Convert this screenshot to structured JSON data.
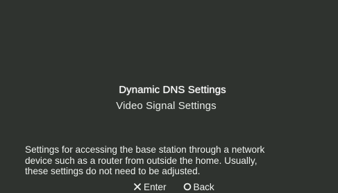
{
  "menu": {
    "items": [
      {
        "label": "Dynamic DNS Settings"
      },
      {
        "label": "Video Signal Settings"
      }
    ]
  },
  "description": {
    "lines": [
      "Settings for accessing the base station through a network",
      "device such as a router from outside the home. Usually,",
      "these settings do not need to be adjusted."
    ]
  },
  "controls": {
    "enter": {
      "icon": "cross-button-icon",
      "label": "Enter"
    },
    "back": {
      "icon": "circle-button-icon",
      "label": "Back"
    }
  },
  "colors": {
    "background": "#2f332f",
    "text": "#e8ece8"
  }
}
